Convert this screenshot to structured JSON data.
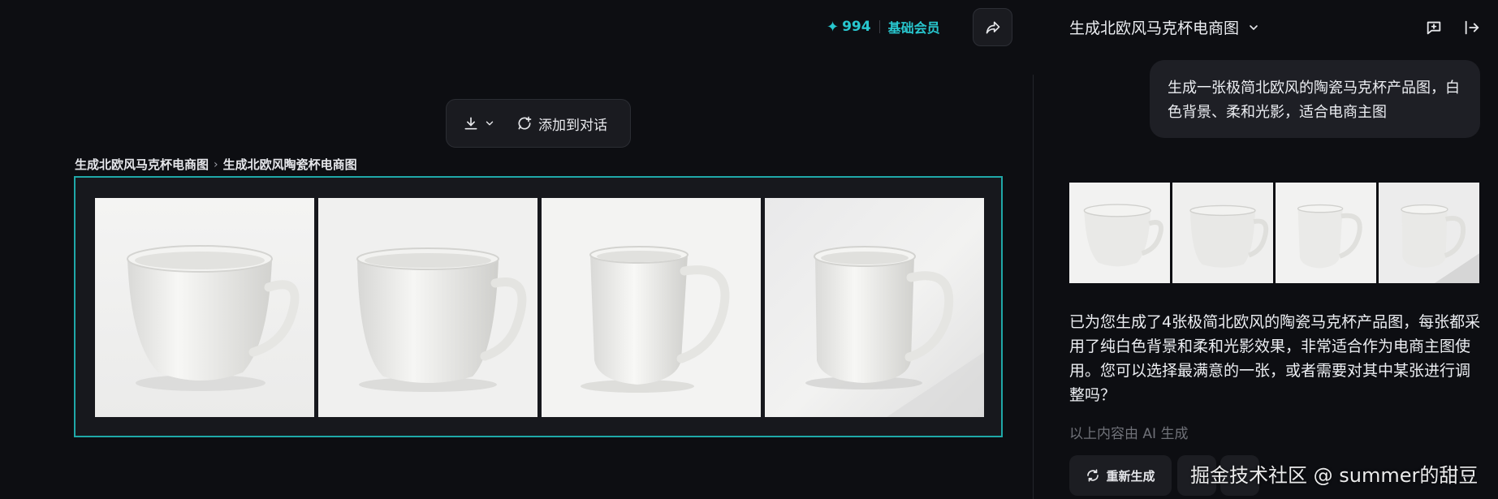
{
  "header": {
    "credits_icon": "sparkle-icon",
    "credits_count": "994",
    "membership": "基础会员",
    "share_icon": "share-icon"
  },
  "toolbar": {
    "download_icon": "download-icon",
    "add_to_chat_label": "添加到对话"
  },
  "breadcrumb": {
    "items": [
      "生成北欧风马克杯电商图",
      "生成北欧风陶瓷杯电商图"
    ]
  },
  "canvas": {
    "images": [
      {
        "alt": "mug-1"
      },
      {
        "alt": "mug-2"
      },
      {
        "alt": "mug-3"
      },
      {
        "alt": "mug-4"
      }
    ]
  },
  "chat": {
    "title": "生成北欧风马克杯电商图",
    "user_message": "生成一张极简北欧风的陶瓷马克杯产品图，白色背景、柔和光影，适合电商主图",
    "ai_message": "已为您生成了4张极简北欧风的陶瓷马克杯产品图，每张都采用了纯白色背景和柔和光影效果，非常适合作为电商主图使用。您可以选择最满意的一张，或者需要对其中某张进行调整吗？",
    "ai_note": "以上内容由 AI 生成",
    "regenerate_label": "重新生成",
    "watermark": "掘金技术社区 @ summer的甜豆"
  },
  "colors": {
    "accent": "#28c7cf",
    "frame_border": "#1fa8a8",
    "background": "#0d0e12"
  }
}
